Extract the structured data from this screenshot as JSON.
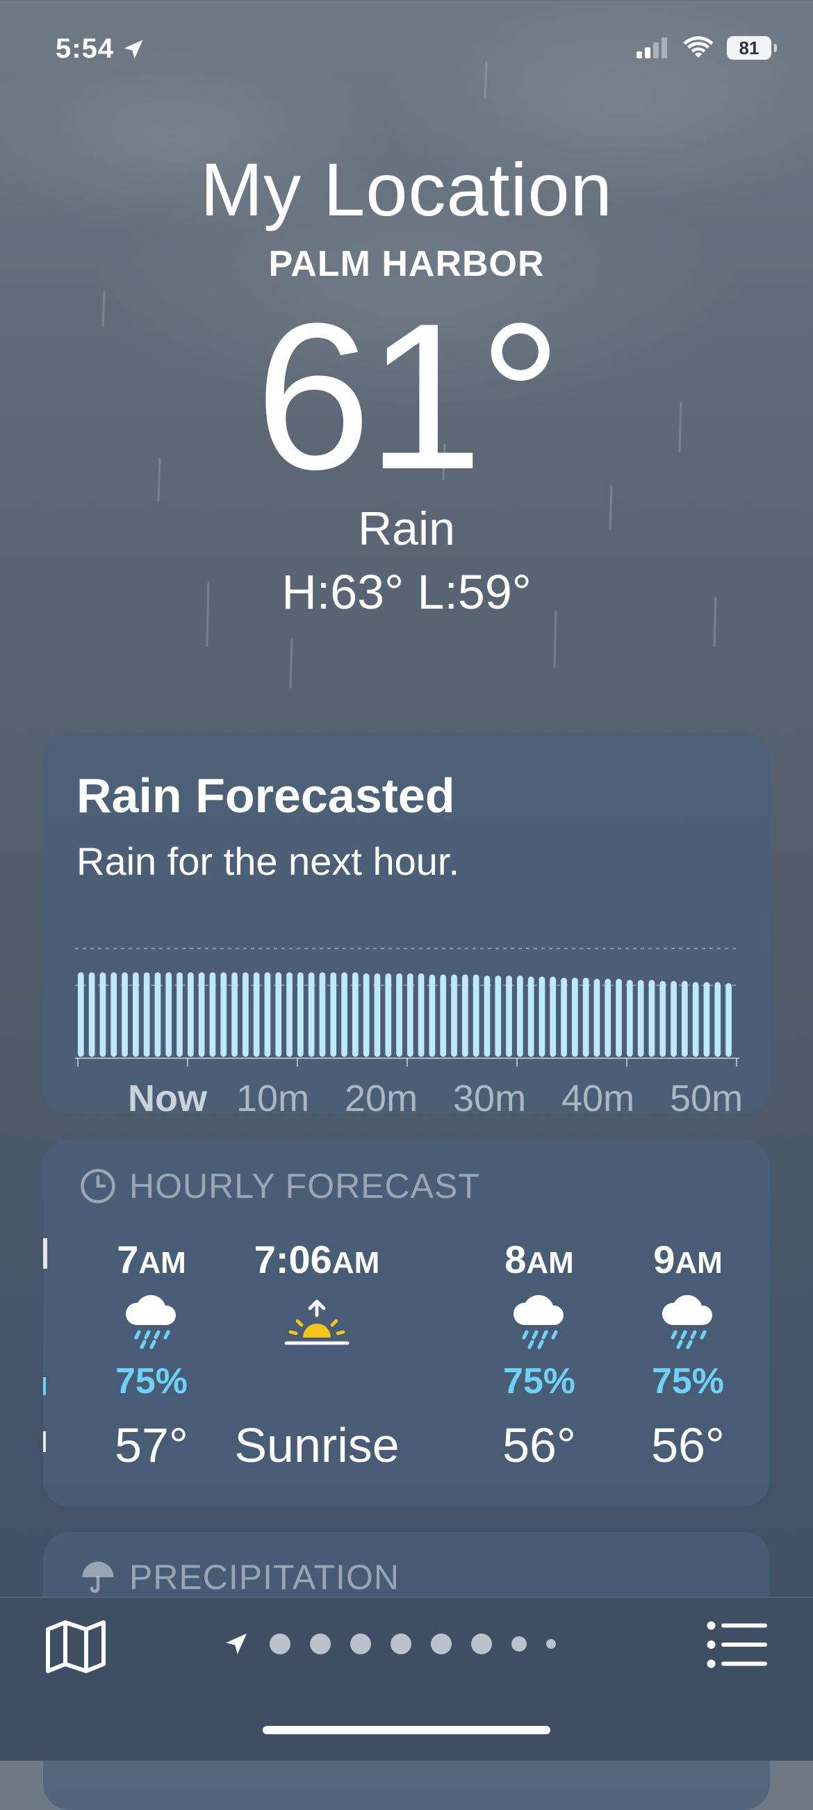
{
  "status_bar": {
    "time": "5:54",
    "battery": "81"
  },
  "location": {
    "title": "My Location",
    "subtitle": "PALM HARBOR"
  },
  "current": {
    "temperature": "61°",
    "condition": "Rain",
    "high_low": "H:63°  L:59°"
  },
  "rain_card": {
    "title": "Rain Forecasted",
    "description": "Rain for the next hour.",
    "x_labels": [
      "Now",
      "10m",
      "20m",
      "30m",
      "40m",
      "50m"
    ],
    "chart_data": {
      "type": "bar",
      "xlabel": "",
      "ylabel": "",
      "categories_minutes": [
        0,
        1,
        2,
        3,
        4,
        5,
        6,
        7,
        8,
        9,
        10,
        11,
        12,
        13,
        14,
        15,
        16,
        17,
        18,
        19,
        20,
        21,
        22,
        23,
        24,
        25,
        26,
        27,
        28,
        29,
        30,
        31,
        32,
        33,
        34,
        35,
        36,
        37,
        38,
        39,
        40,
        41,
        42,
        43,
        44,
        45,
        46,
        47,
        48,
        49,
        50,
        51,
        52,
        53,
        54,
        55,
        56,
        57,
        58,
        59
      ],
      "values": [
        0.78,
        0.78,
        0.78,
        0.78,
        0.78,
        0.78,
        0.78,
        0.78,
        0.78,
        0.78,
        0.78,
        0.78,
        0.78,
        0.78,
        0.78,
        0.78,
        0.78,
        0.78,
        0.78,
        0.78,
        0.78,
        0.78,
        0.78,
        0.78,
        0.78,
        0.78,
        0.77,
        0.77,
        0.77,
        0.77,
        0.77,
        0.77,
        0.76,
        0.76,
        0.76,
        0.76,
        0.76,
        0.75,
        0.75,
        0.75,
        0.75,
        0.74,
        0.74,
        0.74,
        0.73,
        0.73,
        0.73,
        0.72,
        0.72,
        0.72,
        0.71,
        0.71,
        0.71,
        0.7,
        0.7,
        0.7,
        0.69,
        0.69,
        0.69,
        0.68
      ],
      "ylim": [
        0,
        1
      ]
    }
  },
  "hourly": {
    "header": "HOURLY FORECAST",
    "items": [
      {
        "time": "7",
        "ampm": "AM",
        "icon": "cloud-rain-icon",
        "pct": "75%",
        "value": "57°"
      },
      {
        "time": "7:06",
        "ampm": "AM",
        "icon": "sunrise-icon",
        "pct": "",
        "value": "Sunrise"
      },
      {
        "time": "8",
        "ampm": "AM",
        "icon": "cloud-rain-icon",
        "pct": "75%",
        "value": "56°"
      },
      {
        "time": "9",
        "ampm": "AM",
        "icon": "cloud-rain-icon",
        "pct": "75%",
        "value": "56°"
      }
    ]
  },
  "precipitation": {
    "header": "PRECIPITATION"
  },
  "colors": {
    "accent_rain": "#6ed2f8",
    "sun": "#f5c518",
    "bar": "#bfe9fb"
  }
}
